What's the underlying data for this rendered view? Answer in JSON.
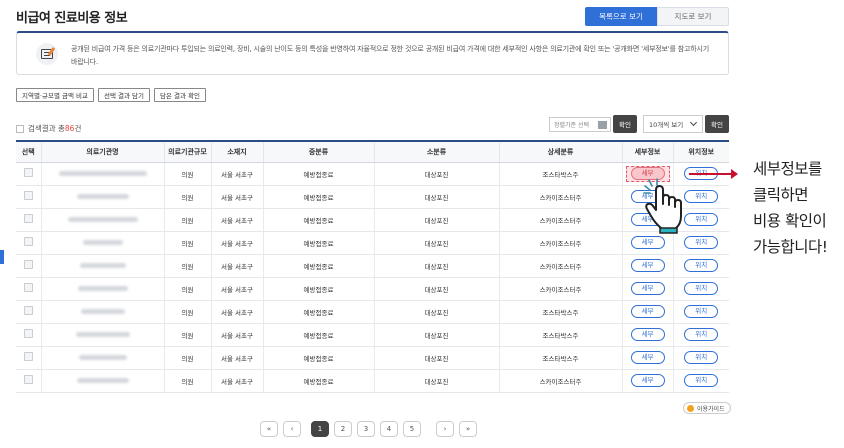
{
  "page": {
    "title": "비급여 진료비용 정보"
  },
  "view_toggle": {
    "list_label": "목록으로 보기",
    "map_label": "지도로 보기"
  },
  "notice": {
    "text": "공개된 비급여 가격 등은 의료기관마다 투입되는 의료인력, 장비, 시술의 난이도 등의 특성을 반영하여 자율적으로 정한 것으로 공개된 비급여 가격에 대한 세부적인 사항은 의료기관에 확인 또는 '공개화면 '세부정보'를 참고하시기 바랍니다."
  },
  "actions": {
    "compare_label": "지역별·규모별 금액 비교",
    "save_label": "선택 결과 담기",
    "check_label": "담은 결과 확인"
  },
  "results": {
    "prefix": "검색결과 총",
    "count": "86",
    "suffix": "건"
  },
  "sort": {
    "placeholder": "정렬기준 선택",
    "confirm_label": "확인"
  },
  "per_page": {
    "value": "10개씩 보기",
    "confirm_label": "확인"
  },
  "table": {
    "headers": [
      "선택",
      "의료기관명",
      "의료기관규모",
      "소재지",
      "중분류",
      "소분류",
      "상세분류",
      "세부정보",
      "위치정보"
    ],
    "detail_label": "세부",
    "location_label": "위치",
    "rows": [
      {
        "size": "의원",
        "location": "서울 서초구",
        "mid": "예방접종료",
        "sub": "대상포진",
        "detail": "조스타박스주"
      },
      {
        "size": "의원",
        "location": "서울 서초구",
        "mid": "예방접종료",
        "sub": "대상포진",
        "detail": "스카이조스터주"
      },
      {
        "size": "의원",
        "location": "서울 서초구",
        "mid": "예방접종료",
        "sub": "대상포진",
        "detail": "스카이조스터주"
      },
      {
        "size": "의원",
        "location": "서울 서초구",
        "mid": "예방접종료",
        "sub": "대상포진",
        "detail": "스카이조스터주"
      },
      {
        "size": "의원",
        "location": "서울 서초구",
        "mid": "예방접종료",
        "sub": "대상포진",
        "detail": "스카이조스터주"
      },
      {
        "size": "의원",
        "location": "서울 서초구",
        "mid": "예방접종료",
        "sub": "대상포진",
        "detail": "스카이조스터주"
      },
      {
        "size": "의원",
        "location": "서울 서초구",
        "mid": "예방접종료",
        "sub": "대상포진",
        "detail": "조스타박스주"
      },
      {
        "size": "의원",
        "location": "서울 서초구",
        "mid": "예방접종료",
        "sub": "대상포진",
        "detail": "조스타박스주"
      },
      {
        "size": "의원",
        "location": "서울 서초구",
        "mid": "예방접종료",
        "sub": "대상포진",
        "detail": "조스타박스주"
      },
      {
        "size": "의원",
        "location": "서울 서초구",
        "mid": "예방접종료",
        "sub": "대상포진",
        "detail": "스카이조스터주"
      }
    ]
  },
  "callout": {
    "text": "세부정보를\n클릭하면\n비용 확인이\n가능합니다!"
  },
  "guide": {
    "label": "이용가이드"
  },
  "pagination": {
    "first": "«",
    "prev": "‹",
    "pages": [
      "1",
      "2",
      "3",
      "4",
      "5"
    ],
    "current": "1",
    "next": "›",
    "last": "»"
  },
  "colors": {
    "primary": "#2f6fd8",
    "header_border": "#2b4d86",
    "highlight": "#e55a66",
    "callout_arrow": "#c8102e"
  }
}
